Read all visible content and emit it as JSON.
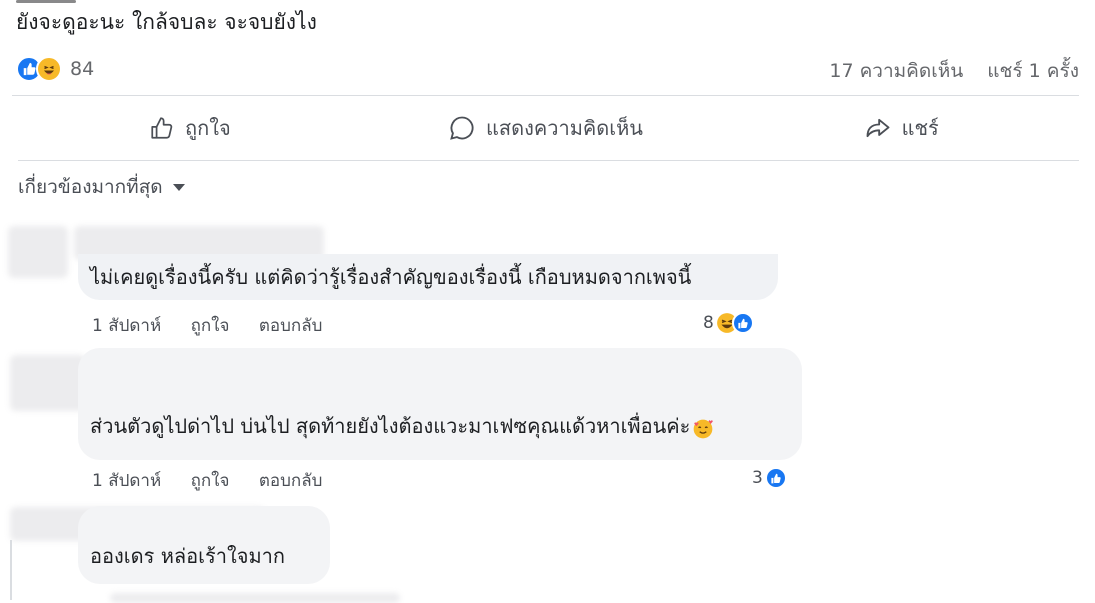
{
  "post": {
    "text": "ยังจะดูอะนะ ใกล้จบละ จะจบยังไง",
    "reaction_count": "84",
    "comment_count": "17 ความคิดเห็น",
    "share_count": "แชร์ 1 ครั้ง"
  },
  "actions": {
    "like_label": "ถูกใจ",
    "comment_label": "แสดงความคิดเห็น",
    "share_label": "แชร์"
  },
  "sort": {
    "label": "เกี่ยวข้องมากที่สุด"
  },
  "comments": [
    {
      "text": "ไม่เคยดูเรื่องนี้ครับ แต่คิดว่ารู้เรื่องสำคัญของเรื่องนี้ เกือบหมดจากเพจนี้",
      "time": "1 สัปดาห์",
      "like_label": "ถูกใจ",
      "reply_label": "ตอบกลับ",
      "reaction_count": "8"
    },
    {
      "text": "ส่วนตัวดูไปด่าไป บ่นไป สุดท้ายยังไงต้องแวะมาเฟซคุณแด้วหาเพื่อนค่ะ",
      "time": "1 สัปดาห์",
      "like_label": "ถูกใจ",
      "reply_label": "ตอบกลับ",
      "reaction_count": "3"
    },
    {
      "text": "อองเดร หล่อเร้าใจมาก"
    }
  ],
  "colors": {
    "like_blue": "#1877f2",
    "haha_yellow": "#f7b928",
    "bubble_bg": "#f0f2f5",
    "secondary_text": "#65676b"
  }
}
